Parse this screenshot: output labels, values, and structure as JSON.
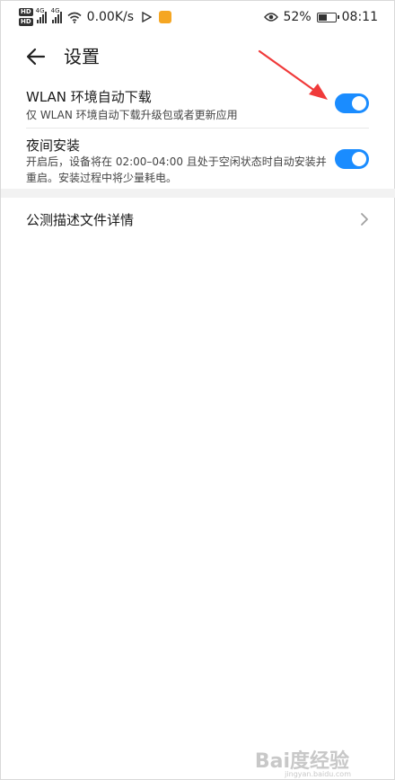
{
  "status_bar": {
    "hd_labels": [
      "HD",
      "HD"
    ],
    "signal_labels": [
      "4G",
      "4G"
    ],
    "net_speed": "0.00K/s",
    "battery_percent": "52%",
    "battery_level": 0.52,
    "time": "08:11",
    "icons": [
      "eye-icon",
      "wifi-icon",
      "play-icon",
      "app-badge-icon"
    ]
  },
  "header": {
    "title": "设置"
  },
  "settings": {
    "wlan": {
      "title": "WLAN 环境自动下载",
      "subtitle": "仅 WLAN 环境自动下载升级包或者更新应用",
      "enabled": true
    },
    "night": {
      "title": "夜间安装",
      "subtitle_line1": "开启后，设备将在 02:00–04:00 且处于空闲状态时自动安装并",
      "subtitle_line2": "重启。安装过程中将少量耗电。",
      "enabled": true
    },
    "beta": {
      "title": "公测描述文件详情"
    }
  },
  "watermark": {
    "text": "Bai度经验",
    "sub": "jingyan.baidu.com"
  },
  "colors": {
    "toggle_on": "#1a8cff",
    "annotation": "#f03a3a",
    "section_band": "#f2f2f2"
  }
}
